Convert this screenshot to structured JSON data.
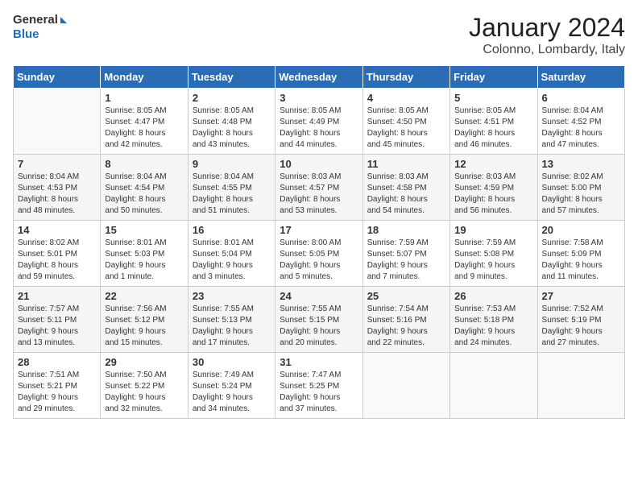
{
  "header": {
    "logo_general": "General",
    "logo_blue": "Blue",
    "month": "January 2024",
    "location": "Colonno, Lombardy, Italy"
  },
  "days_of_week": [
    "Sunday",
    "Monday",
    "Tuesday",
    "Wednesday",
    "Thursday",
    "Friday",
    "Saturday"
  ],
  "weeks": [
    [
      {
        "day": "",
        "info": ""
      },
      {
        "day": "1",
        "info": "Sunrise: 8:05 AM\nSunset: 4:47 PM\nDaylight: 8 hours\nand 42 minutes."
      },
      {
        "day": "2",
        "info": "Sunrise: 8:05 AM\nSunset: 4:48 PM\nDaylight: 8 hours\nand 43 minutes."
      },
      {
        "day": "3",
        "info": "Sunrise: 8:05 AM\nSunset: 4:49 PM\nDaylight: 8 hours\nand 44 minutes."
      },
      {
        "day": "4",
        "info": "Sunrise: 8:05 AM\nSunset: 4:50 PM\nDaylight: 8 hours\nand 45 minutes."
      },
      {
        "day": "5",
        "info": "Sunrise: 8:05 AM\nSunset: 4:51 PM\nDaylight: 8 hours\nand 46 minutes."
      },
      {
        "day": "6",
        "info": "Sunrise: 8:04 AM\nSunset: 4:52 PM\nDaylight: 8 hours\nand 47 minutes."
      }
    ],
    [
      {
        "day": "7",
        "info": "Sunrise: 8:04 AM\nSunset: 4:53 PM\nDaylight: 8 hours\nand 48 minutes."
      },
      {
        "day": "8",
        "info": "Sunrise: 8:04 AM\nSunset: 4:54 PM\nDaylight: 8 hours\nand 50 minutes."
      },
      {
        "day": "9",
        "info": "Sunrise: 8:04 AM\nSunset: 4:55 PM\nDaylight: 8 hours\nand 51 minutes."
      },
      {
        "day": "10",
        "info": "Sunrise: 8:03 AM\nSunset: 4:57 PM\nDaylight: 8 hours\nand 53 minutes."
      },
      {
        "day": "11",
        "info": "Sunrise: 8:03 AM\nSunset: 4:58 PM\nDaylight: 8 hours\nand 54 minutes."
      },
      {
        "day": "12",
        "info": "Sunrise: 8:03 AM\nSunset: 4:59 PM\nDaylight: 8 hours\nand 56 minutes."
      },
      {
        "day": "13",
        "info": "Sunrise: 8:02 AM\nSunset: 5:00 PM\nDaylight: 8 hours\nand 57 minutes."
      }
    ],
    [
      {
        "day": "14",
        "info": "Sunrise: 8:02 AM\nSunset: 5:01 PM\nDaylight: 8 hours\nand 59 minutes."
      },
      {
        "day": "15",
        "info": "Sunrise: 8:01 AM\nSunset: 5:03 PM\nDaylight: 9 hours\nand 1 minute."
      },
      {
        "day": "16",
        "info": "Sunrise: 8:01 AM\nSunset: 5:04 PM\nDaylight: 9 hours\nand 3 minutes."
      },
      {
        "day": "17",
        "info": "Sunrise: 8:00 AM\nSunset: 5:05 PM\nDaylight: 9 hours\nand 5 minutes."
      },
      {
        "day": "18",
        "info": "Sunrise: 7:59 AM\nSunset: 5:07 PM\nDaylight: 9 hours\nand 7 minutes."
      },
      {
        "day": "19",
        "info": "Sunrise: 7:59 AM\nSunset: 5:08 PM\nDaylight: 9 hours\nand 9 minutes."
      },
      {
        "day": "20",
        "info": "Sunrise: 7:58 AM\nSunset: 5:09 PM\nDaylight: 9 hours\nand 11 minutes."
      }
    ],
    [
      {
        "day": "21",
        "info": "Sunrise: 7:57 AM\nSunset: 5:11 PM\nDaylight: 9 hours\nand 13 minutes."
      },
      {
        "day": "22",
        "info": "Sunrise: 7:56 AM\nSunset: 5:12 PM\nDaylight: 9 hours\nand 15 minutes."
      },
      {
        "day": "23",
        "info": "Sunrise: 7:55 AM\nSunset: 5:13 PM\nDaylight: 9 hours\nand 17 minutes."
      },
      {
        "day": "24",
        "info": "Sunrise: 7:55 AM\nSunset: 5:15 PM\nDaylight: 9 hours\nand 20 minutes."
      },
      {
        "day": "25",
        "info": "Sunrise: 7:54 AM\nSunset: 5:16 PM\nDaylight: 9 hours\nand 22 minutes."
      },
      {
        "day": "26",
        "info": "Sunrise: 7:53 AM\nSunset: 5:18 PM\nDaylight: 9 hours\nand 24 minutes."
      },
      {
        "day": "27",
        "info": "Sunrise: 7:52 AM\nSunset: 5:19 PM\nDaylight: 9 hours\nand 27 minutes."
      }
    ],
    [
      {
        "day": "28",
        "info": "Sunrise: 7:51 AM\nSunset: 5:21 PM\nDaylight: 9 hours\nand 29 minutes."
      },
      {
        "day": "29",
        "info": "Sunrise: 7:50 AM\nSunset: 5:22 PM\nDaylight: 9 hours\nand 32 minutes."
      },
      {
        "day": "30",
        "info": "Sunrise: 7:49 AM\nSunset: 5:24 PM\nDaylight: 9 hours\nand 34 minutes."
      },
      {
        "day": "31",
        "info": "Sunrise: 7:47 AM\nSunset: 5:25 PM\nDaylight: 9 hours\nand 37 minutes."
      },
      {
        "day": "",
        "info": ""
      },
      {
        "day": "",
        "info": ""
      },
      {
        "day": "",
        "info": ""
      }
    ]
  ]
}
